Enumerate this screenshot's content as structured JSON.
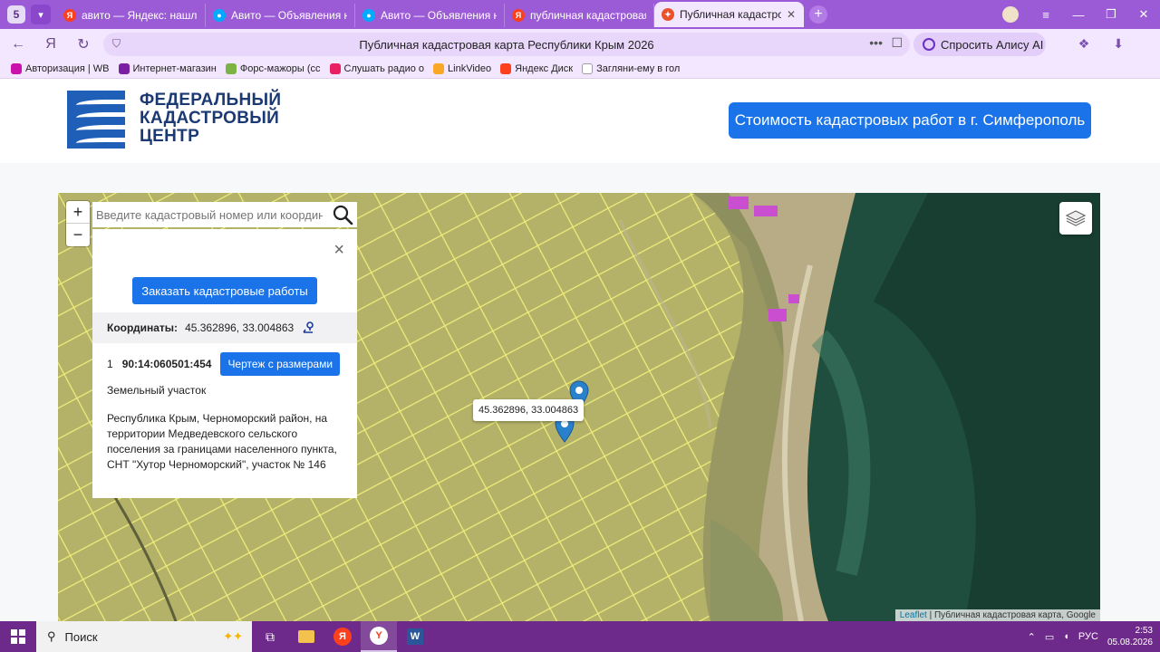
{
  "browser": {
    "tab_count": "5",
    "tabs": [
      {
        "title": "авито — Яндекс: нашлось",
        "icon": "yandex-icon",
        "color": "#fc3f1d"
      },
      {
        "title": "Авито — Объявления на с",
        "icon": "avito-icon",
        "color": "#00aaff"
      },
      {
        "title": "Авито — Объявления на с",
        "icon": "avito-icon",
        "color": "#00aaff"
      },
      {
        "title": "публичная кадастровая к",
        "icon": "yandex-icon",
        "color": "#fc3f1d"
      },
      {
        "title": "Публичная кадастровая к",
        "icon": "cadastre-icon",
        "color": "#e8532b",
        "active": true
      }
    ],
    "page_title": "Публичная кадастровая карта Республики Крым 2026",
    "alice_button": "Спросить Алису AI",
    "bookmarks": [
      {
        "label": "Авторизация | WB",
        "color": "#cb11ab"
      },
      {
        "label": "Интернет-магазин",
        "color": "#7b1fa2"
      },
      {
        "label": "Форс-мажоры (сс",
        "color": "#7cb342"
      },
      {
        "label": "Слушать радио о",
        "color": "#e91e63"
      },
      {
        "label": "LinkVideo",
        "color": "#f9a825"
      },
      {
        "label": "Яндекс Диск",
        "color": "#fc3f1d"
      },
      {
        "label": "Загляни-ему в гол",
        "color": "#9e9e9e"
      }
    ]
  },
  "site": {
    "logo_lines": [
      "ФЕДЕРАЛЬНЫЙ",
      "КАДАСТРОВЫЙ",
      "ЦЕНТР"
    ],
    "cta_button": "Стоимость кадастровых работ в г. Симферополь",
    "brand_color": "#1a73e8"
  },
  "map": {
    "search_placeholder": "Введите кадастровый номер или координаты",
    "zoom_in": "+",
    "zoom_out": "−",
    "marker_label": "45.362896, 33.004863",
    "attribution_link": "Leaflet",
    "attribution_text": " | Публичная кадастровая карта, Google"
  },
  "popup": {
    "close": "×",
    "order_button": "Заказать кадастровые работы",
    "coords_label": "Координаты:",
    "coords_value": "45.362896, 33.004863",
    "index": "1",
    "cadastral_number": "90:14:060501:454",
    "drawing_button": "Чертеж с размерами",
    "parcel_type": "Земельный участок",
    "address": "Республика Крым, Черноморский район, на территории Медведевского сельского поселения за границами населенного пункта, СНТ \"Хутор Черноморский\", участок № 146"
  },
  "taskbar": {
    "search_label": "Поиск",
    "language": "РУС",
    "time": "2:53",
    "date": "05.08.2026"
  }
}
